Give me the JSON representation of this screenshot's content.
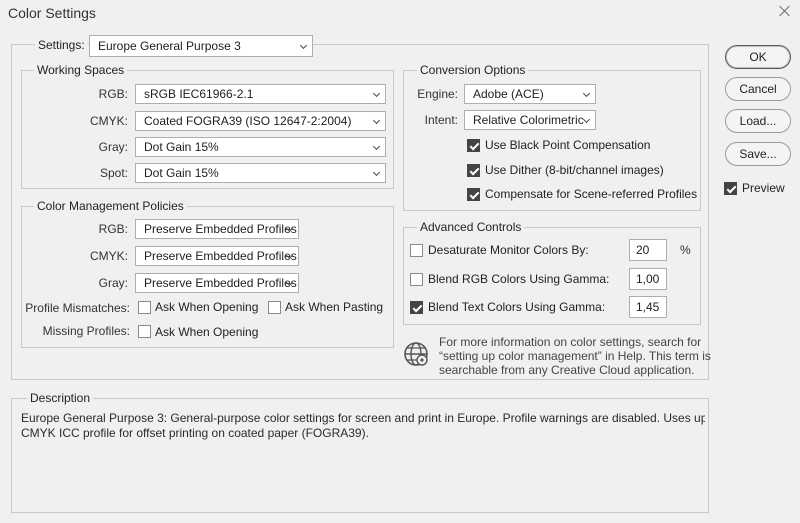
{
  "window": {
    "title": "Color Settings"
  },
  "settings": {
    "label": "Settings:",
    "value": "Europe General Purpose 3"
  },
  "working_spaces": {
    "legend": "Working Spaces",
    "rows": [
      {
        "label": "RGB:",
        "value": "sRGB IEC61966-2.1"
      },
      {
        "label": "CMYK:",
        "value": "Coated FOGRA39 (ISO 12647-2:2004)"
      },
      {
        "label": "Gray:",
        "value": "Dot Gain 15%"
      },
      {
        "label": "Spot:",
        "value": "Dot Gain 15%"
      }
    ]
  },
  "policies": {
    "legend": "Color Management Policies",
    "rows": [
      {
        "label": "RGB:",
        "value": "Preserve Embedded Profiles"
      },
      {
        "label": "CMYK:",
        "value": "Preserve Embedded Profiles"
      },
      {
        "label": "Gray:",
        "value": "Preserve Embedded Profiles"
      }
    ],
    "mismatches_label": "Profile Mismatches:",
    "ask_opening": {
      "label": "Ask When Opening",
      "checked": false
    },
    "ask_pasting": {
      "label": "Ask When Pasting",
      "checked": false
    },
    "missing_label": "Missing Profiles:",
    "missing_ask_opening": {
      "label": "Ask When Opening",
      "checked": false
    }
  },
  "conversion": {
    "legend": "Conversion Options",
    "engine_label": "Engine:",
    "engine_value": "Adobe (ACE)",
    "intent_label": "Intent:",
    "intent_value": "Relative Colorimetric",
    "options": [
      {
        "label": "Use Black Point Compensation",
        "checked": true
      },
      {
        "label": "Use Dither (8-bit/channel images)",
        "checked": true
      },
      {
        "label": "Compensate for Scene-referred Profiles",
        "checked": true
      }
    ]
  },
  "advanced": {
    "legend": "Advanced Controls",
    "desaturate": {
      "label": "Desaturate Monitor Colors By:",
      "checked": false,
      "value": "20",
      "unit": "%"
    },
    "blend_rgb": {
      "label": "Blend RGB Colors Using Gamma:",
      "checked": false,
      "value": "1,00"
    },
    "blend_text": {
      "label": "Blend Text Colors Using Gamma:",
      "checked": true,
      "value": "1,45"
    }
  },
  "info": {
    "icon": "globe-icon",
    "lines": [
      "For more information on color settings, search for",
      "“setting up color management” in Help. This term is",
      "searchable from any Creative Cloud application."
    ]
  },
  "buttons": {
    "ok": "OK",
    "cancel": "Cancel",
    "load": "Load...",
    "save": "Save..."
  },
  "preview": {
    "label": "Preview",
    "checked": true
  },
  "description": {
    "legend": "Description",
    "lines": [
      "Europe General Purpose 3:  General-purpose color settings for screen and print in Europe. Profile warnings are disabled. Uses updated",
      "CMYK ICC profile for offset printing on coated paper (FOGRA39)."
    ]
  }
}
